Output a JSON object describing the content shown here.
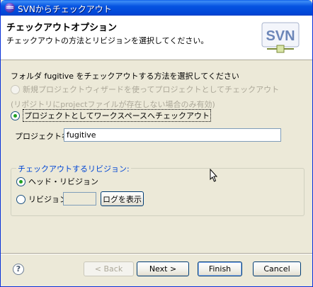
{
  "window": {
    "title": "SVNからチェックアウト"
  },
  "header": {
    "title": "チェックアウトオプション",
    "description": "チェックアウトの方法とリビジョンを選択してください。",
    "logo_text": "SVN"
  },
  "options": {
    "prompt": "フォルダ fugitive をチェックアウトする方法を選択してください",
    "radio_new_project_wizard": "新規プロジェクトウィザードを使ってプロジェクトとしてチェックアウト",
    "note": "(リポジトリにprojectファイルが存在しない場合のみ有効)",
    "radio_workspace_project": "プロジェクトとしてワークスペースへチェックアウト",
    "project_name_label": "プロジェクト名:",
    "project_name_value": "fugitive"
  },
  "revision_group": {
    "legend": "チェックアウトするリビジョン:",
    "head_label": "ヘッド・リビジョン",
    "revision_label": "リビジョン",
    "revision_value": "",
    "show_log_button": "ログを表示"
  },
  "footer": {
    "help_icon": "?",
    "back_button": "< Back",
    "next_button": "Next >",
    "finish_button": "Finish",
    "cancel_button": "Cancel"
  },
  "colors": {
    "titlebar": "#0553e1",
    "dialog_bg": "#ece9d8",
    "group_legend": "#0046d5",
    "radio_dot": "#21a121"
  }
}
